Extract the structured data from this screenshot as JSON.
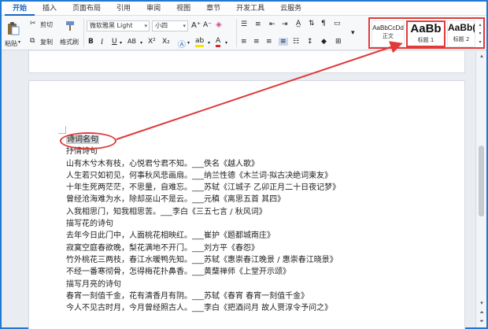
{
  "tabs": [
    "开始",
    "插入",
    "页面布局",
    "引用",
    "审阅",
    "视图",
    "章节",
    "开发工具",
    "云服务"
  ],
  "ribbon": {
    "paste_label": "粘贴",
    "cut_label": "剪切",
    "copy_label": "复制",
    "format_painter_label": "格式刷",
    "font_name": "微软雅黑 Light",
    "font_size": "小四",
    "styles": [
      {
        "preview": "AaBbCcDd",
        "caption": "正文"
      },
      {
        "preview": "AaBb",
        "caption": "标题 1"
      },
      {
        "preview": "AaBb(",
        "caption": "标题 2"
      }
    ]
  },
  "document": {
    "lines": [
      "诗词名句",
      "抒情诗句",
      "山有木兮木有枝，心悦君兮君不知。___佚名《越人歌》",
      "人生若只如初见，何事秋风悲画扇。___纳兰性德《木兰词·拟古决绝词柬友》",
      "十年生死两茫茫，不思量，自难忘。___苏轼《江城子 乙卯正月二十日夜记梦》",
      "曾经沧海难为水，除却巫山不是云。___元稹《离思五首 其四》",
      "入我相思门，知我相思苦。___李白《三五七言 / 秋风词》",
      "描写花的诗句",
      "去年今日此门中，人面桃花相映红。___崔护《题都城南庄》",
      "寂寞空庭春欲晚，梨花满地不开门。___刘方平《春怨》",
      "竹外桃花三两枝，春江水暖鸭先知。___苏轼《惠崇春江晚景 / 惠崇春江晓景》",
      "不经一番寒彻骨，怎得梅花扑鼻香。___黄蘖禅师《上堂开示颂》",
      "描写月亮的诗句",
      "春宵一刻值千金，花有清香月有阴。___苏轼《春宵 春宵一刻值千金》",
      "今人不见古时月，今月曾经照古人。___李白《把酒问月 故人贾淳令予问之》"
    ]
  },
  "colors": {
    "accent": "#1a66c2",
    "annotation_red": "#e03a3a",
    "selection_gray": "#c9ccd1"
  }
}
